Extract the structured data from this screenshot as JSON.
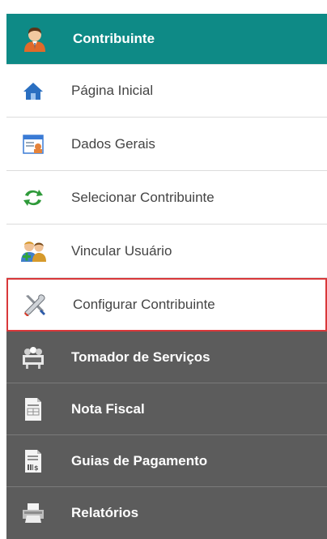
{
  "menu": {
    "header": {
      "label": "Contribuinte",
      "icon": "user-avatar-icon"
    },
    "items": [
      {
        "label": "Página Inicial",
        "icon": "home-icon"
      },
      {
        "label": "Dados Gerais",
        "icon": "id-card-icon"
      },
      {
        "label": "Selecionar Contribuinte",
        "icon": "swap-arrows-icon"
      },
      {
        "label": "Vincular Usuário",
        "icon": "add-users-icon"
      },
      {
        "label": "Configurar Contribuinte",
        "icon": "tools-icon"
      }
    ],
    "sections": [
      {
        "label": "Tomador de Serviços",
        "icon": "group-icon"
      },
      {
        "label": "Nota Fiscal",
        "icon": "invoice-icon"
      },
      {
        "label": "Guias de Pagamento",
        "icon": "payment-slip-icon"
      },
      {
        "label": "Relatórios",
        "icon": "printer-icon"
      }
    ]
  },
  "colors": {
    "header_bg": "#0e8a86",
    "dark_bg": "#5c5c5c",
    "active_border": "#d9383a"
  }
}
